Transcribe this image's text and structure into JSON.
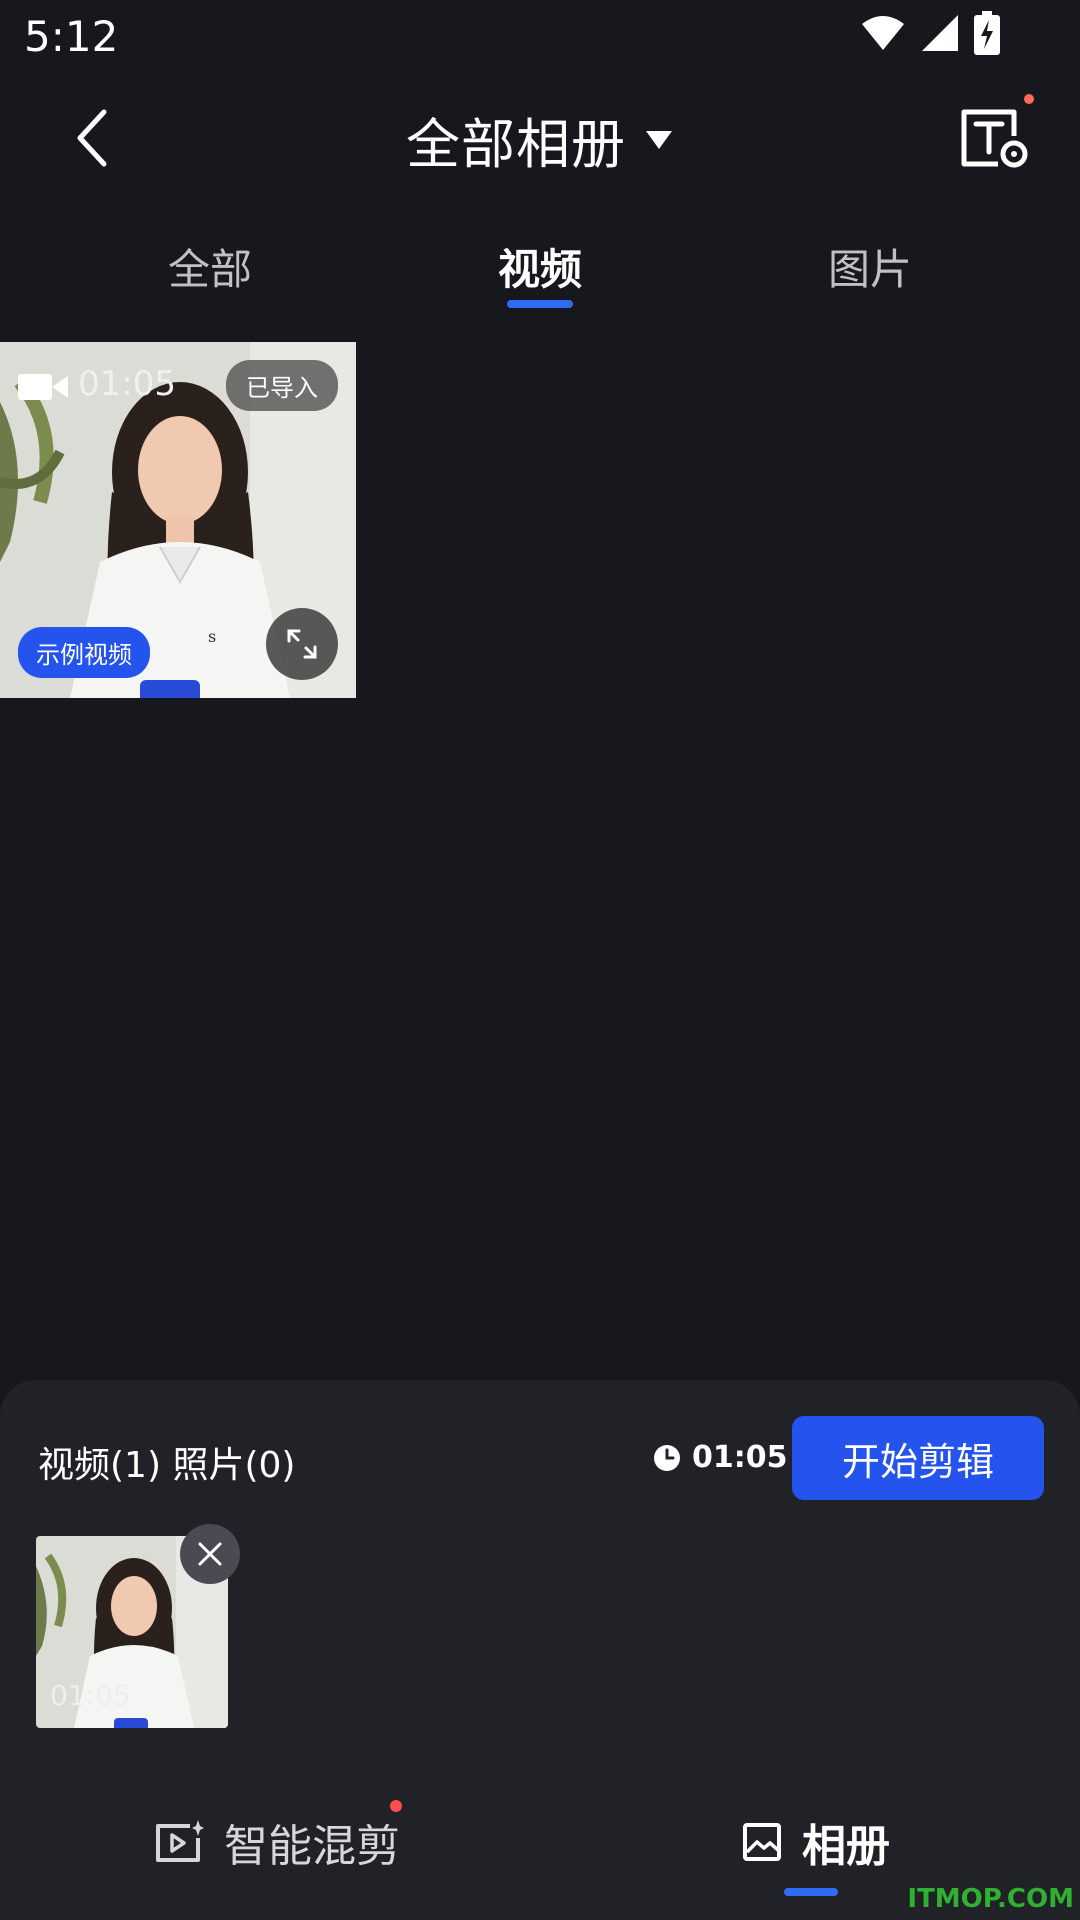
{
  "status": {
    "time": "5:12"
  },
  "header": {
    "album_title": "全部相册"
  },
  "tabs": [
    {
      "label": "全部"
    },
    {
      "label": "视频"
    },
    {
      "label": "图片"
    }
  ],
  "media_tile": {
    "duration": "01:05",
    "imported_badge": "已导入",
    "sample_badge": "示例视频"
  },
  "panel": {
    "counts": "视频(1) 照片(0)",
    "total_time": "01:05",
    "start_label": "开始剪辑",
    "selected_duration": "01:05"
  },
  "nav": {
    "smart_cut": "智能混剪",
    "album": "相册"
  },
  "watermark": "ITMOP.COM",
  "colors": {
    "accent": "#2453ee",
    "tab_underline": "#2f6cf6",
    "background": "#17181d",
    "panel": "#212228"
  }
}
